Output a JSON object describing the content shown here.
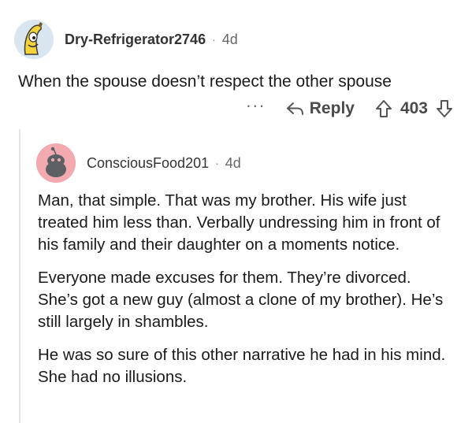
{
  "comment": {
    "author": "Dry-Refrigerator2746",
    "separator": "·",
    "age": "4d",
    "body": "When the spouse doesn’t respect the other spouse",
    "more_label": "···",
    "reply_label": "Reply",
    "score": "403",
    "avatar_icon": "snoo-banana-avatar-icon"
  },
  "reply": {
    "author": "ConsciousFood201",
    "separator": "·",
    "age": "4d",
    "avatar_icon": "snoo-default-avatar-icon",
    "paragraphs": [
      "Man, that simple. That was my brother. His wife just treated him less than. Verbally undressing him in front of his family and their daughter on a moments notice.",
      "Everyone made excuses for them. They’re divorced. She’s got a new guy (almost a clone of my brother). He’s still largely in shambles.",
      "He was so sure of this other narrative he had in his mind. She had no illusions."
    ]
  },
  "colors": {
    "text": "#1c1c1c",
    "meta": "#666666",
    "thread_line": "#e4e4e4",
    "reply_avatar_bg": "#f2aab0"
  }
}
